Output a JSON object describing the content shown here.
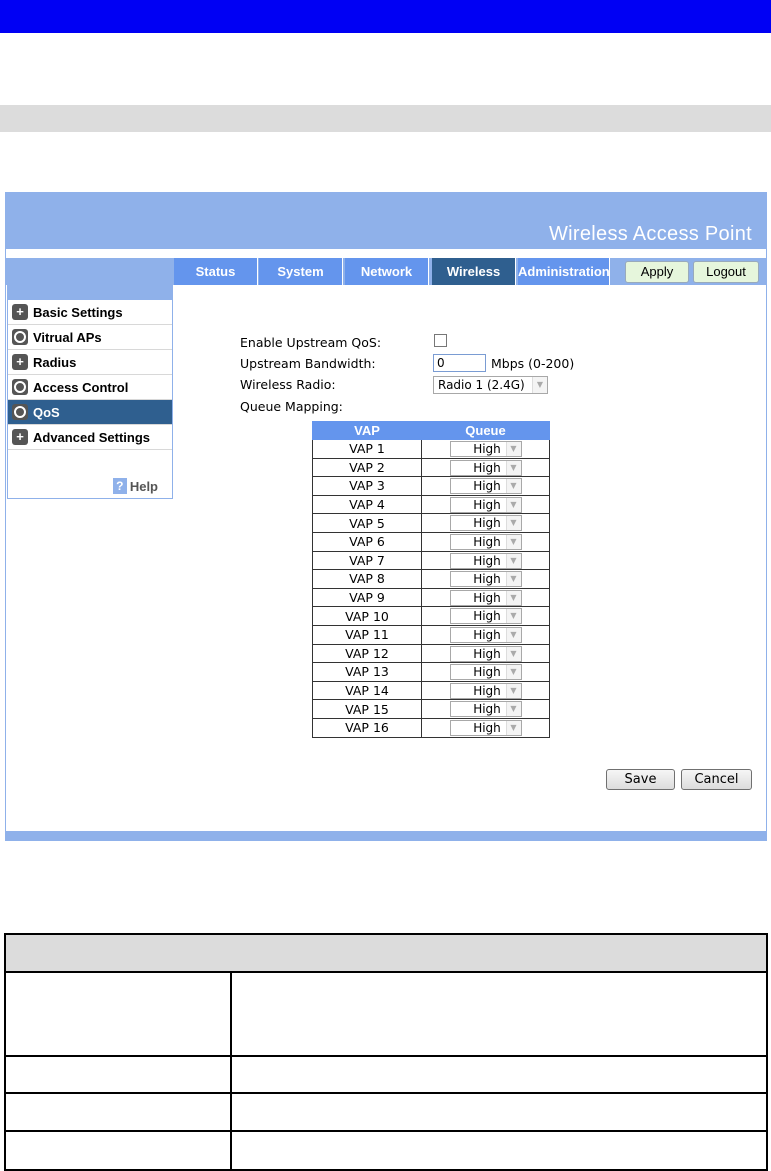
{
  "app": {
    "title": "Wireless Access Point"
  },
  "nav": {
    "tabs": [
      "Status",
      "System",
      "Network",
      "Wireless",
      "Administration"
    ],
    "active": "Wireless",
    "apply_label": "Apply",
    "logout_label": "Logout"
  },
  "sidebar": {
    "items": [
      {
        "label": "Basic Settings",
        "icon": "plus-icon"
      },
      {
        "label": "Vitrual APs",
        "icon": "circle-icon"
      },
      {
        "label": "Radius",
        "icon": "plus-icon"
      },
      {
        "label": "Access Control",
        "icon": "circle-icon"
      },
      {
        "label": "QoS",
        "icon": "circle-icon",
        "active": true
      },
      {
        "label": "Advanced Settings",
        "icon": "plus-icon"
      }
    ],
    "help_icon": "?",
    "help_label": "Help"
  },
  "form": {
    "enable_label": "Enable Upstream QoS:",
    "enable_checked": false,
    "bandwidth_label": "Upstream Bandwidth:",
    "bandwidth_value": "0",
    "bandwidth_unit": "Mbps (0-200)",
    "radio_label": "Wireless Radio:",
    "radio_value": "Radio 1 (2.4G)",
    "queue_label": "Queue Mapping:"
  },
  "queue_table": {
    "headers": [
      "VAP",
      "Queue"
    ],
    "rows": [
      {
        "vap": "VAP 1",
        "queue": "High"
      },
      {
        "vap": "VAP 2",
        "queue": "High"
      },
      {
        "vap": "VAP 3",
        "queue": "High"
      },
      {
        "vap": "VAP 4",
        "queue": "High"
      },
      {
        "vap": "VAP 5",
        "queue": "High"
      },
      {
        "vap": "VAP 6",
        "queue": "High"
      },
      {
        "vap": "VAP 7",
        "queue": "High"
      },
      {
        "vap": "VAP 8",
        "queue": "High"
      },
      {
        "vap": "VAP 9",
        "queue": "High"
      },
      {
        "vap": "VAP 10",
        "queue": "High"
      },
      {
        "vap": "VAP 11",
        "queue": "High"
      },
      {
        "vap": "VAP 12",
        "queue": "High"
      },
      {
        "vap": "VAP 13",
        "queue": "High"
      },
      {
        "vap": "VAP 14",
        "queue": "High"
      },
      {
        "vap": "VAP 15",
        "queue": "High"
      },
      {
        "vap": "VAP 16",
        "queue": "High"
      }
    ]
  },
  "actions": {
    "save_label": "Save",
    "cancel_label": "Cancel"
  },
  "colors": {
    "top_bar": "#0000f4",
    "accent": "#8fb1ea",
    "tab": "#6495ed",
    "tab_active": "#2f5f8f"
  }
}
